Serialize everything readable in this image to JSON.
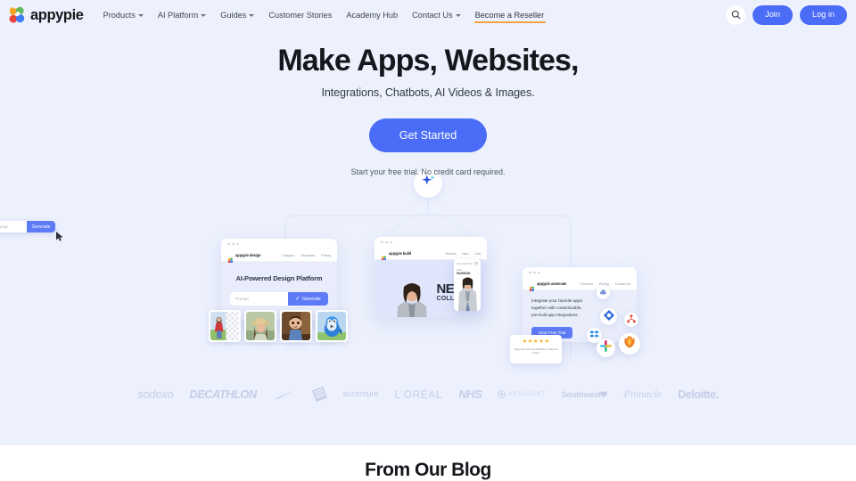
{
  "brand": {
    "name": "appypie",
    "logo_colors": [
      "#f5a623",
      "#5cb85c",
      "#4a6cf7",
      "#e8453c"
    ],
    "accent": "#4a6cf7",
    "underline_accent": "#f2a33c",
    "hero_background": "#edf1fd"
  },
  "nav": {
    "items": [
      {
        "label": "Products",
        "has_dropdown": true
      },
      {
        "label": "AI Platform",
        "has_dropdown": true
      },
      {
        "label": "Guides",
        "has_dropdown": true
      },
      {
        "label": "Customer Stories",
        "has_dropdown": false
      },
      {
        "label": "Academy Hub",
        "has_dropdown": false
      },
      {
        "label": "Contact Us",
        "has_dropdown": true
      },
      {
        "label": "Become a Reseller",
        "has_dropdown": false,
        "underlined": true
      }
    ],
    "search_icon": "search-icon",
    "join_label": "Join",
    "login_label": "Log in"
  },
  "hero": {
    "title": "Make Apps, Websites,",
    "subtitle": "Integrations, Chatbots, AI Videos & Images.",
    "cta_label": "Get Started",
    "cta_note": "Start your free trial. No credit card required."
  },
  "illustration": {
    "spark_icon": "sparkle-ai-icon",
    "design_card": {
      "product": "appypie design",
      "nav": [
        "Category",
        "Templates",
        "Pricing"
      ],
      "headline": "AI-Powered Design Platform",
      "prompt_placeholder": "Prompt",
      "generate_label": "Generate",
      "thumbnails": [
        {
          "name": "thumb-woman-transparent-bg"
        },
        {
          "name": "thumb-woman-hat"
        },
        {
          "name": "thumb-cartoon-boy"
        },
        {
          "name": "thumb-blue-bird-video",
          "has_play": true
        }
      ]
    },
    "fashion_card": {
      "product": "appypie build",
      "nav": [
        "Brands",
        "New",
        "Cart"
      ],
      "headline_line1": "NEW.",
      "headline_line2": "COLLECTION",
      "prompt_placeholder": "Prompt",
      "generate_label": "Generate"
    },
    "phone_card": {
      "label": "COLLECTION",
      "sub_line1": "NEW",
      "sub_line2": "FASHION"
    },
    "integrate_card": {
      "product": "appypie automate",
      "nav": [
        "Features",
        "Pricing",
        "Contact Us"
      ],
      "body": "Integrate your favorite apps together with customizable, pre-built app integrations.",
      "cta_label": "Start Free Trial",
      "app_icons": [
        "cloud-app-icon",
        "diamond-app-icon",
        "sitemap-app-icon",
        "dropbox-icon",
        "slack-icon",
        "firefox-icon"
      ]
    },
    "review_card": {
      "stars": "★★★★★",
      "rating": 5,
      "quote": "\"Appy Pie is the true definition of value for money.\""
    }
  },
  "brands": {
    "items": [
      {
        "label": "sodexo",
        "style": "sodexo"
      },
      {
        "label": "DECATHLON",
        "style": "decathlon"
      },
      {
        "label": "nike-swoosh-icon",
        "style": "nike"
      },
      {
        "label": "home-depot-icon",
        "style": "homedepot"
      },
      {
        "label": "accenture",
        "style": "accenture"
      },
      {
        "label": "L'ORÉAL",
        "style": "loreal"
      },
      {
        "label": "NHS",
        "style": "nhs"
      },
      {
        "label": "ASSURANT",
        "style": "assurant"
      },
      {
        "label": "Southwest",
        "style": "southwest"
      },
      {
        "label": "Pinnacle",
        "style": "pinnacle"
      },
      {
        "label": "Deloitte.",
        "style": "deloitte"
      }
    ]
  },
  "blog": {
    "title": "From Our Blog"
  }
}
